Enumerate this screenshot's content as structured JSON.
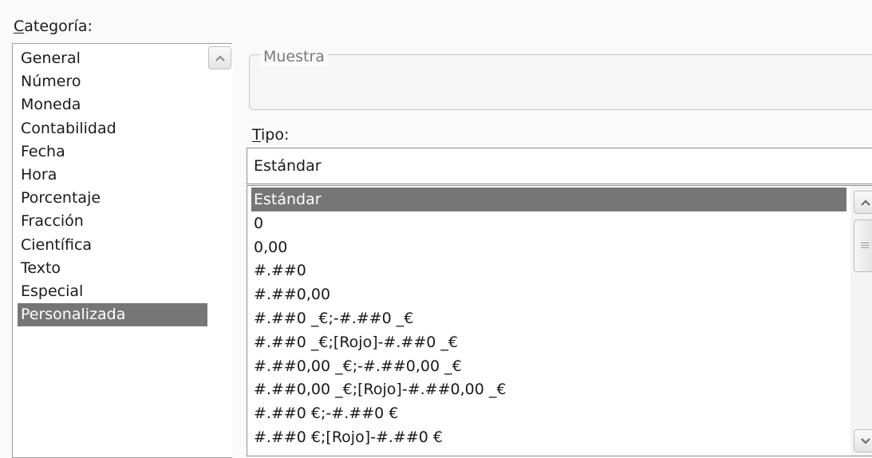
{
  "category": {
    "label_first": "C",
    "label_rest": "ategoría:",
    "items": [
      "General",
      "Número",
      "Moneda",
      "Contabilidad",
      "Fecha",
      "Hora",
      "Porcentaje",
      "Fracción",
      "Científica",
      "Texto",
      "Especial",
      "Personalizada"
    ],
    "selected_index": 11,
    "scroll_up_icon": "chevron-up-icon"
  },
  "sample": {
    "legend": "Muestra",
    "value": ""
  },
  "type": {
    "label_first": "T",
    "label_rest": "ipo:",
    "input_value": "Estándar",
    "items": [
      "Estándar",
      "0",
      "0,00",
      "#.##0",
      "#.##0,00",
      "#.##0 _€;-#.##0 _€",
      "#.##0 _€;[Rojo]-#.##0 _€",
      "#.##0,00 _€;-#.##0,00 _€",
      "#.##0,00 _€;[Rojo]-#.##0,00 _€",
      "#.##0 €;-#.##0 €",
      "#.##0 €;[Rojo]-#.##0 €"
    ],
    "selected_index": 0,
    "scroll_up_icon": "chevron-up-icon",
    "scroll_down_icon": "chevron-down-icon"
  },
  "colors": {
    "selection": "#767676",
    "selection_text": "#ffffff",
    "background": "#fafafa"
  }
}
